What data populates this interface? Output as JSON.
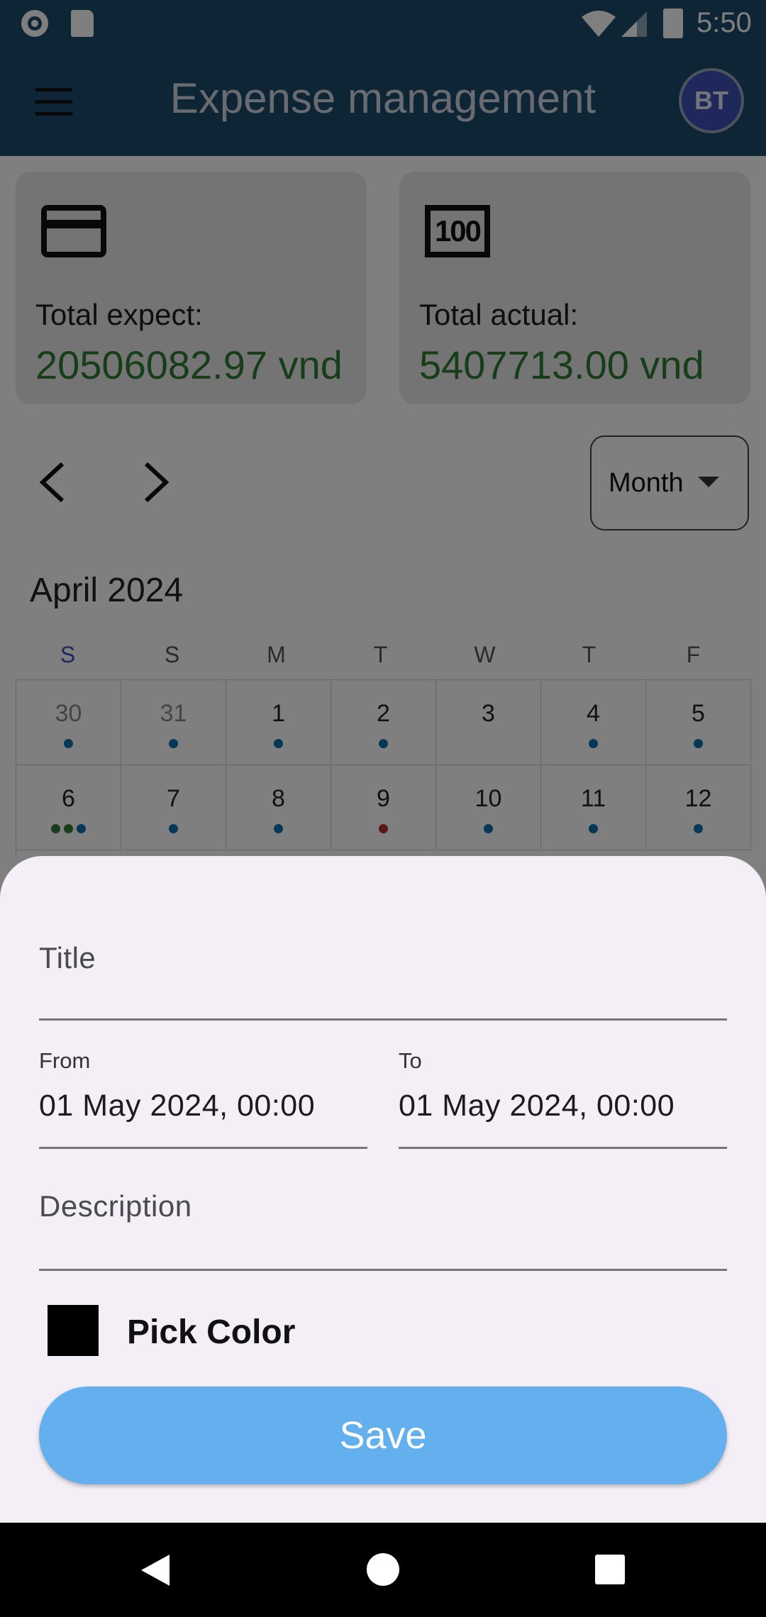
{
  "status_bar": {
    "time": "5:50"
  },
  "app_bar": {
    "title": "Expense management",
    "avatar_initials": "BT"
  },
  "summary": {
    "expect_label": "Total expect:",
    "expect_value": "20506082.97 vnd",
    "actual_label": "Total actual:",
    "actual_value": "5407713.00 vnd"
  },
  "view_selector": {
    "value": "Month"
  },
  "calendar": {
    "month_title": "April 2024",
    "weekdays": [
      "S",
      "S",
      "M",
      "T",
      "W",
      "T",
      "F"
    ],
    "week1": [
      "30",
      "31",
      "1",
      "2",
      "3",
      "4",
      "5"
    ],
    "week2": [
      "6",
      "7",
      "8",
      "9",
      "10",
      "11",
      "12"
    ]
  },
  "form": {
    "title_label": "Title",
    "from_label": "From",
    "from_value": "01 May 2024, 00:00",
    "to_label": "To",
    "to_value": "01 May 2024, 00:00",
    "description_label": "Description",
    "pick_color_label": "Pick Color",
    "selected_color": "#000000",
    "save_label": "Save"
  },
  "colors": {
    "primary": "#1b4a6b",
    "amount_green": "#2e7d32",
    "save_button": "#64b0ee",
    "sheet_bg": "#f4eff6"
  }
}
